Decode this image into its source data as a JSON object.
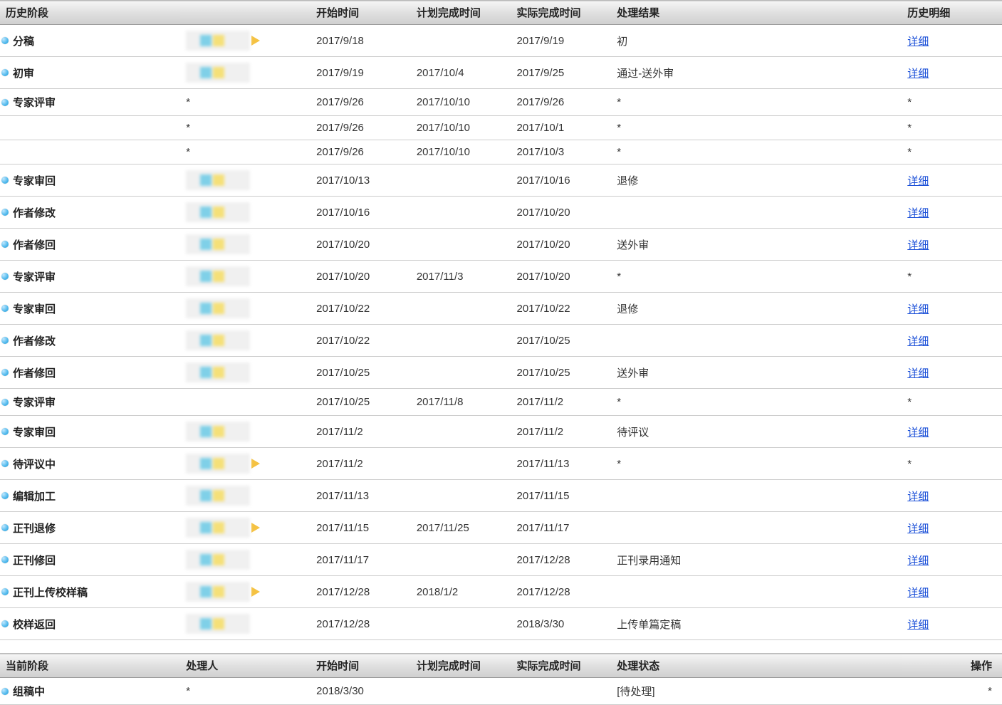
{
  "history": {
    "headers": {
      "stage": "历史阶段",
      "start": "开始时间",
      "plan": "计划完成时间",
      "actual": "实际完成时间",
      "result": "处理结果",
      "detail": "历史明细"
    },
    "detail_link_label": "详细",
    "rows": [
      {
        "stage": "分稿",
        "has_bullet": true,
        "handler_redacted": true,
        "has_arrow": true,
        "start": "2017/9/18",
        "plan": "",
        "actual": "2017/9/19",
        "result": "初",
        "detail": "link"
      },
      {
        "stage": "初审",
        "has_bullet": true,
        "handler_redacted": true,
        "has_arrow": false,
        "start": "2017/9/19",
        "plan": "2017/10/4",
        "actual": "2017/9/25",
        "result": "通过-送外审",
        "detail": "link"
      },
      {
        "stage": "专家评审",
        "has_bullet": true,
        "handler_text": "*",
        "has_arrow": false,
        "start": "2017/9/26",
        "plan": "2017/10/10",
        "actual": "2017/9/26",
        "result": "*",
        "detail": "*"
      },
      {
        "stage": "",
        "has_bullet": false,
        "handler_text": "*",
        "has_arrow": false,
        "start": "2017/9/26",
        "plan": "2017/10/10",
        "actual": "2017/10/1",
        "result": "*",
        "detail": "*"
      },
      {
        "stage": "",
        "has_bullet": false,
        "handler_text": "*",
        "has_arrow": false,
        "start": "2017/9/26",
        "plan": "2017/10/10",
        "actual": "2017/10/3",
        "result": "*",
        "detail": "*"
      },
      {
        "stage": "专家审回",
        "has_bullet": true,
        "handler_redacted": true,
        "has_arrow": false,
        "start": "2017/10/13",
        "plan": "",
        "actual": "2017/10/16",
        "result": "退修",
        "detail": "link"
      },
      {
        "stage": "作者修改",
        "has_bullet": true,
        "handler_redacted": true,
        "has_arrow": false,
        "start": "2017/10/16",
        "plan": "",
        "actual": "2017/10/20",
        "result": "",
        "detail": "link"
      },
      {
        "stage": "作者修回",
        "has_bullet": true,
        "handler_redacted": true,
        "has_arrow": false,
        "start": "2017/10/20",
        "plan": "",
        "actual": "2017/10/20",
        "result": "送外审",
        "detail": "link"
      },
      {
        "stage": "专家评审",
        "has_bullet": true,
        "handler_redacted": true,
        "has_arrow": false,
        "start": "2017/10/20",
        "plan": "2017/11/3",
        "actual": "2017/10/20",
        "result": "*",
        "detail": "*"
      },
      {
        "stage": "专家审回",
        "has_bullet": true,
        "handler_redacted": true,
        "has_arrow": false,
        "start": "2017/10/22",
        "plan": "",
        "actual": "2017/10/22",
        "result": "退修",
        "detail": "link"
      },
      {
        "stage": "作者修改",
        "has_bullet": true,
        "handler_redacted": true,
        "has_arrow": false,
        "start": "2017/10/22",
        "plan": "",
        "actual": "2017/10/25",
        "result": "",
        "detail": "link"
      },
      {
        "stage": "作者修回",
        "has_bullet": true,
        "handler_redacted": true,
        "has_arrow": false,
        "start": "2017/10/25",
        "plan": "",
        "actual": "2017/10/25",
        "result": "送外审",
        "detail": "link"
      },
      {
        "stage": "专家评审",
        "has_bullet": true,
        "handler_redacted": false,
        "has_arrow": false,
        "start": "2017/10/25",
        "plan": "2017/11/8",
        "actual": "2017/11/2",
        "result": "*",
        "detail": "*"
      },
      {
        "stage": "专家审回",
        "has_bullet": true,
        "handler_redacted": true,
        "has_arrow": false,
        "start": "2017/11/2",
        "plan": "",
        "actual": "2017/11/2",
        "result": "待评议",
        "detail": "link"
      },
      {
        "stage": "待评议中",
        "has_bullet": true,
        "handler_redacted": true,
        "has_arrow": true,
        "start": "2017/11/2",
        "plan": "",
        "actual": "2017/11/13",
        "result": "*",
        "detail": "*"
      },
      {
        "stage": "编辑加工",
        "has_bullet": true,
        "handler_redacted": true,
        "has_arrow": false,
        "start": "2017/11/13",
        "plan": "",
        "actual": "2017/11/15",
        "result": "",
        "detail": "link"
      },
      {
        "stage": "正刊退修",
        "has_bullet": true,
        "handler_redacted": true,
        "has_arrow": true,
        "start": "2017/11/15",
        "plan": "2017/11/25",
        "actual": "2017/11/17",
        "result": "",
        "detail": "link"
      },
      {
        "stage": "正刊修回",
        "has_bullet": true,
        "handler_redacted": true,
        "has_arrow": false,
        "start": "2017/11/17",
        "plan": "",
        "actual": "2017/12/28",
        "result": "正刊录用通知",
        "detail": "link"
      },
      {
        "stage": "正刊上传校样稿",
        "has_bullet": true,
        "handler_redacted": true,
        "has_arrow": true,
        "start": "2017/12/28",
        "plan": "2018/1/2",
        "actual": "2017/12/28",
        "result": "",
        "detail": "link"
      },
      {
        "stage": "校样返回",
        "has_bullet": true,
        "handler_redacted": true,
        "has_arrow": false,
        "start": "2017/12/28",
        "plan": "",
        "actual": "2018/3/30",
        "result": "上传单篇定稿",
        "detail": "link"
      }
    ]
  },
  "current": {
    "headers": {
      "stage": "当前阶段",
      "handler": "处理人",
      "start": "开始时间",
      "plan": "计划完成时间",
      "actual": "实际完成时间",
      "status": "处理状态",
      "action": "操作"
    },
    "rows": [
      {
        "stage": "组稿中",
        "has_bullet": true,
        "handler": "*",
        "start": "2018/3/30",
        "plan": "",
        "actual": "",
        "status": "[待处理]",
        "action": "*"
      }
    ]
  }
}
